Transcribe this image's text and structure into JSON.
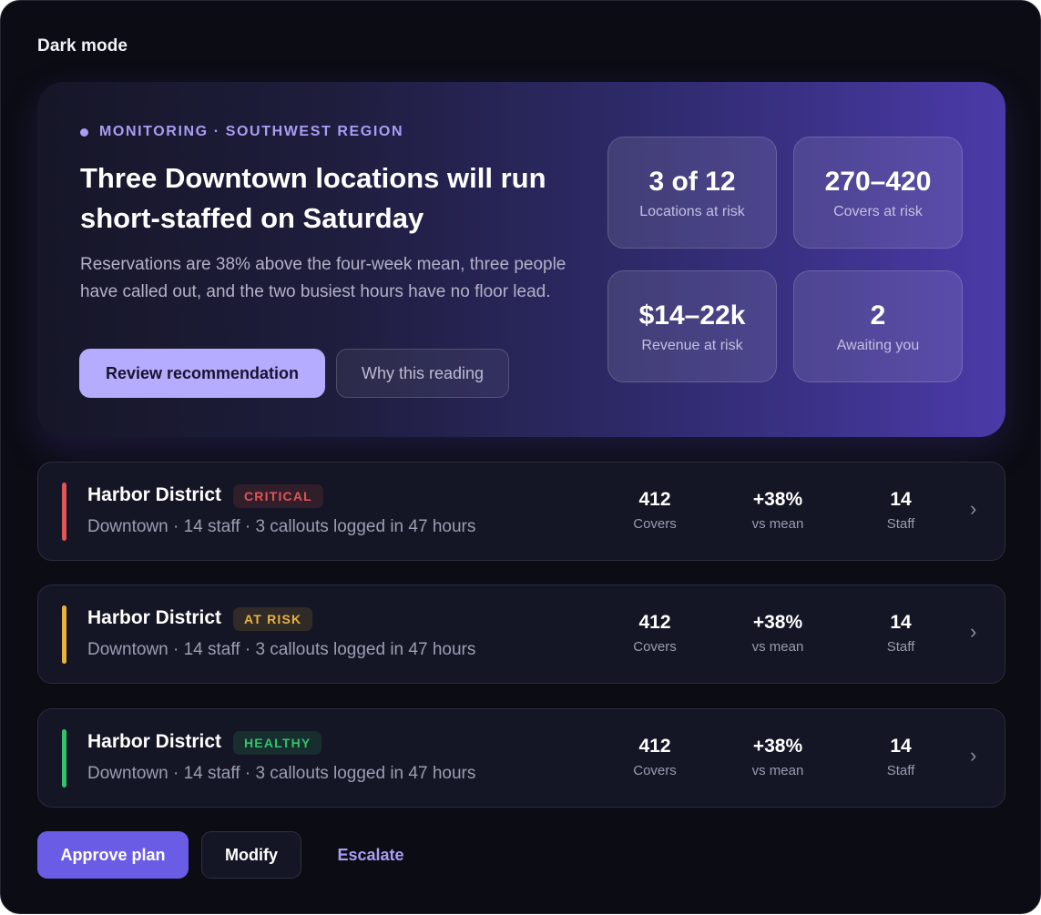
{
  "mode_label": "Dark mode",
  "hero": {
    "eyebrow": "MONITORING · SOUTHWEST REGION",
    "title": "Three Downtown locations will run short-staffed on Saturday",
    "description": "Reservations are 38% above the four-week mean, three people have called out, and the two busiest hours have no floor lead.",
    "primary_button": "Review recommendation",
    "secondary_button": "Why this reading",
    "stats": [
      {
        "value": "3 of 12",
        "label": "Locations at risk"
      },
      {
        "value": "270–420",
        "label": "Covers at risk"
      },
      {
        "value": "$14–22k",
        "label": "Revenue at risk"
      },
      {
        "value": "2",
        "label": "Awaiting you"
      }
    ]
  },
  "locations": [
    {
      "name": "Harbor District",
      "status": "CRITICAL",
      "status_color": "#e05555",
      "subtitle": "Downtown · 14 staff · 3 callouts logged in 47 hours",
      "metrics": [
        {
          "value": "412",
          "label": "Covers"
        },
        {
          "value": "+38%",
          "label": "vs mean"
        },
        {
          "value": "14",
          "label": "Staff"
        }
      ]
    },
    {
      "name": "Harbor District",
      "status": "AT RISK",
      "status_color": "#e6b341",
      "subtitle": "Downtown · 14 staff · 3 callouts logged in 47 hours",
      "metrics": [
        {
          "value": "412",
          "label": "Covers"
        },
        {
          "value": "+38%",
          "label": "vs mean"
        },
        {
          "value": "14",
          "label": "Staff"
        }
      ]
    },
    {
      "name": "Harbor District",
      "status": "HEALTHY",
      "status_color": "#34c26a",
      "subtitle": "Downtown · 14 staff · 3 callouts logged in 47 hours",
      "metrics": [
        {
          "value": "412",
          "label": "Covers"
        },
        {
          "value": "+38%",
          "label": "vs mean"
        },
        {
          "value": "14",
          "label": "Staff"
        }
      ]
    }
  ],
  "actions": {
    "approve": "Approve plan",
    "modify": "Modify",
    "escalate": "Escalate"
  },
  "icons": {
    "row_chevron": "chevron-right-icon",
    "eyebrow_dot": "status-dot-icon"
  }
}
